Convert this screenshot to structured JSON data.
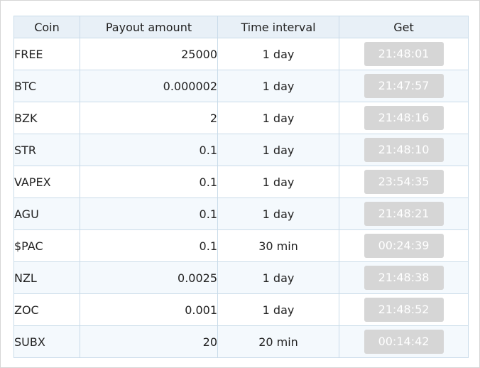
{
  "table": {
    "headers": {
      "coin": "Coin",
      "payout": "Payout amount",
      "interval": "Time interval",
      "get": "Get"
    },
    "rows": [
      {
        "coin": "FREE",
        "payout": "25000",
        "interval": "1 day",
        "timer": "21:48:01"
      },
      {
        "coin": "BTC",
        "payout": "0.000002",
        "interval": "1 day",
        "timer": "21:47:57"
      },
      {
        "coin": "BZK",
        "payout": "2",
        "interval": "1 day",
        "timer": "21:48:16"
      },
      {
        "coin": "STR",
        "payout": "0.1",
        "interval": "1 day",
        "timer": "21:48:10"
      },
      {
        "coin": "VAPEX",
        "payout": "0.1",
        "interval": "1 day",
        "timer": "23:54:35"
      },
      {
        "coin": "AGU",
        "payout": "0.1",
        "interval": "1 day",
        "timer": "21:48:21"
      },
      {
        "coin": "$PAC",
        "payout": "0.1",
        "interval": "30 min",
        "timer": "00:24:39"
      },
      {
        "coin": "NZL",
        "payout": "0.0025",
        "interval": "1 day",
        "timer": "21:48:38"
      },
      {
        "coin": "ZOC",
        "payout": "0.001",
        "interval": "1 day",
        "timer": "21:48:52"
      },
      {
        "coin": "SUBX",
        "payout": "20",
        "interval": "20 min",
        "timer": "00:14:42"
      }
    ]
  },
  "colors": {
    "header_bg": "#e8f0f7",
    "row_alt_bg": "#f4f9fd",
    "border": "#c9dbe9",
    "button_disabled_bg": "#d6d6d6",
    "button_text": "#ffffff"
  }
}
